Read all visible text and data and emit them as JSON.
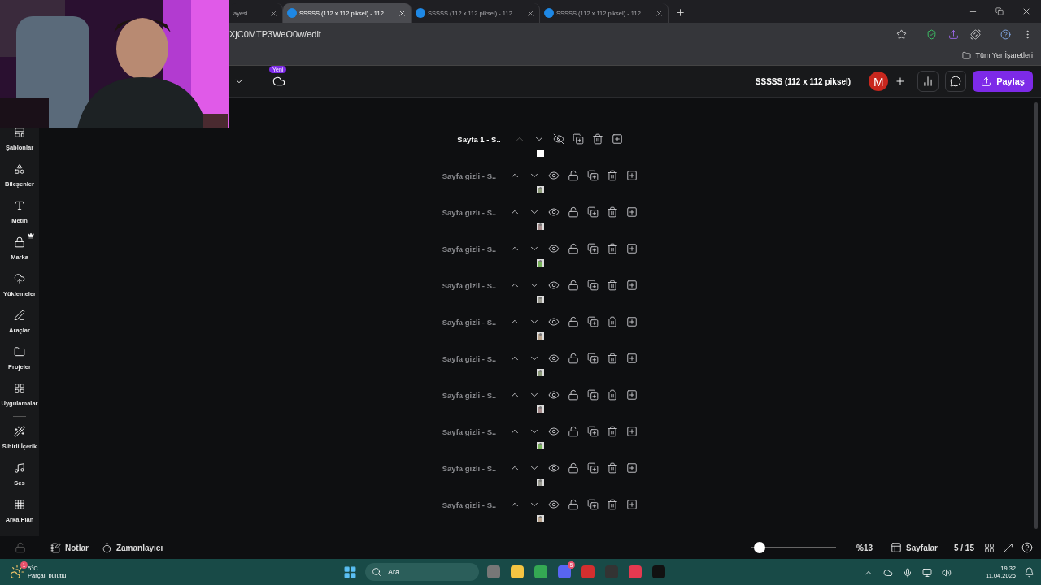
{
  "browser": {
    "tabs": [
      {
        "title": "ayesi",
        "kind": "partial",
        "selected": false
      },
      {
        "title": "SSSSS (112 x 112 piksel) - 112",
        "kind": "page",
        "selected": true
      },
      {
        "title": "SSSSS (112 x 112 piksel) - 112",
        "kind": "page",
        "selected": false
      },
      {
        "title": "SSSSS (112 x 112 piksel) - 112",
        "kind": "page",
        "selected": false
      }
    ],
    "url": "XjC0MTP3WeO0w/edit",
    "bookmarks_label": "Tüm Yer İşaretleri"
  },
  "editor": {
    "new_badge": "Yeni",
    "doc_title": "SSSSS (112 x 112 piksel)",
    "avatar": "M",
    "share": "Paylaş"
  },
  "sidebar": {
    "items": [
      {
        "kind": "item",
        "label": "Şablonlar",
        "premium": false
      },
      {
        "kind": "item",
        "label": "Bileşenler",
        "premium": false
      },
      {
        "kind": "item",
        "label": "Metin",
        "premium": false
      },
      {
        "kind": "item",
        "label": "Marka",
        "premium": true
      },
      {
        "kind": "item",
        "label": "Yüklemeler",
        "premium": false
      },
      {
        "kind": "item",
        "label": "Araçlar",
        "premium": false
      },
      {
        "kind": "item",
        "label": "Projeler",
        "premium": false
      },
      {
        "kind": "item",
        "label": "Uygulamalar",
        "premium": false
      },
      {
        "kind": "divider"
      },
      {
        "kind": "item",
        "label": "Sihirli İçerik",
        "premium": false
      },
      {
        "kind": "item",
        "label": "Ses",
        "premium": false
      },
      {
        "kind": "item",
        "label": "Arka Plan",
        "premium": false
      }
    ]
  },
  "pages": [
    {
      "title": "Sayfa 1 - S..",
      "selected": true,
      "hidden": false,
      "thumbnail": {
        "kind": "blank"
      }
    },
    {
      "title": "Sayfa gizli - S..",
      "selected": false,
      "hidden": true
    },
    {
      "title": "Sayfa gizli - S..",
      "selected": false,
      "hidden": true
    },
    {
      "title": "Sayfa gizli - S..",
      "selected": false,
      "hidden": true
    },
    {
      "title": "Sayfa gizli - S..",
      "selected": false,
      "hidden": true
    },
    {
      "title": "Sayfa gizli - S..",
      "selected": false,
      "hidden": true
    },
    {
      "title": "Sayfa gizli - S..",
      "selected": false,
      "hidden": true
    },
    {
      "title": "Sayfa gizli - S..",
      "selected": false,
      "hidden": true
    },
    {
      "title": "Sayfa gizli - S..",
      "selected": false,
      "hidden": true
    },
    {
      "title": "Sayfa gizli - S..",
      "selected": false,
      "hidden": true
    },
    {
      "title": "Sayfa gizli - S..",
      "selected": false,
      "hidden": true
    }
  ],
  "footer": {
    "notes": "Notlar",
    "timer": "Zamanlayıcı",
    "zoom": {
      "level": 0.1,
      "reading": "%13"
    },
    "pages_button": "Sayfalar",
    "page_count": "5 / 15"
  },
  "taskbar": {
    "weather": {
      "badge": "1",
      "temperature": "5°C",
      "condition": "Parçalı bulutlu"
    },
    "search_placeholder": "Ara",
    "chat_badge": "5",
    "time": "19:32",
    "date": "11.04.2026"
  }
}
